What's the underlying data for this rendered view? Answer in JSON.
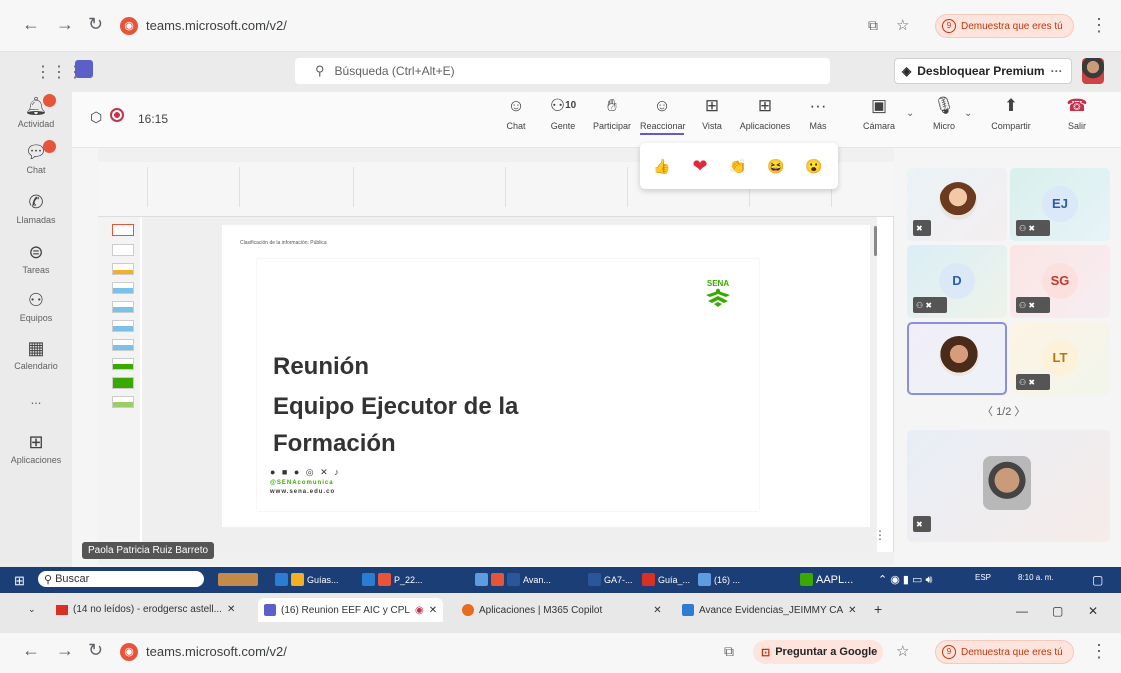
{
  "browser_top": {
    "url": "teams.microsoft.com/v2/",
    "profile_pill": "Demuestra que eres tú",
    "profile_badge": "9"
  },
  "teams_header": {
    "search_placeholder": "Búsqueda (Ctrl+Alt+E)",
    "premium_label": "Desbloquear Premium"
  },
  "rail": [
    {
      "label": "Actividad",
      "icon": "bell-icon"
    },
    {
      "label": "Chat",
      "icon": "chat-icon"
    },
    {
      "label": "Llamadas",
      "icon": "phone-icon"
    },
    {
      "label": "Tareas",
      "icon": "tasks-icon"
    },
    {
      "label": "Equipos",
      "icon": "teams-icon"
    },
    {
      "label": "Calendario",
      "icon": "calendar-icon"
    },
    {
      "label": "...",
      "icon": "more-icon"
    },
    {
      "label": "Aplicaciones",
      "icon": "apps-icon"
    }
  ],
  "meeting": {
    "time": "16:15",
    "participant_count": "10",
    "toolbar": [
      {
        "label": "Chat",
        "icon": "chat-icon"
      },
      {
        "label": "Gente",
        "icon": "people-icon"
      },
      {
        "label": "Participar",
        "icon": "raise-hand-icon"
      },
      {
        "label": "Reaccionar",
        "icon": "smiley-icon"
      },
      {
        "label": "Vista",
        "icon": "view-grid-icon"
      },
      {
        "label": "Aplicaciones",
        "icon": "add-app-icon"
      },
      {
        "label": "Más",
        "icon": "more-icon"
      },
      {
        "label": "Cámara",
        "icon": "camera-off-icon"
      },
      {
        "label": "Micro",
        "icon": "mic-off-icon"
      },
      {
        "label": "Compartir",
        "icon": "share-icon"
      },
      {
        "label": "Salir",
        "icon": "leave-icon"
      }
    ],
    "reactions": [
      {
        "icon": "like-icon",
        "glyph": "👍",
        "color": "#f2b024"
      },
      {
        "icon": "heart-icon",
        "glyph": "❤",
        "color": "#e02a3a"
      },
      {
        "icon": "clap-icon",
        "glyph": "👏",
        "color": "#f2b024"
      },
      {
        "icon": "laugh-icon",
        "glyph": "😆",
        "color": "#f2b024"
      },
      {
        "icon": "surprised-icon",
        "glyph": "😮",
        "color": "#f2b024"
      }
    ]
  },
  "slide": {
    "classification": "Clasificación de la información: Pública",
    "title_lines": [
      "Reunión",
      "Equipo Ejecutor de la",
      "Formación"
    ],
    "handle": "@SENAcomunica",
    "website": "www.sena.edu.co",
    "logo_text": "SENA",
    "social_icons": "● ■ ● ◎ ✕ ♪"
  },
  "presenter_name": "Paola Patricia Ruiz Barreto",
  "participants": {
    "tiles": [
      {
        "initials": "",
        "type": "photo"
      },
      {
        "initials": "EJ",
        "type": "avatar",
        "bg": "#dbe8f7",
        "fg": "#2c5ea8"
      },
      {
        "initials": "D",
        "type": "avatar",
        "bg": "#dbe8f7",
        "fg": "#2c5ea8"
      },
      {
        "initials": "SG",
        "type": "avatar",
        "bg": "#fbe0de",
        "fg": "#c23a2e"
      },
      {
        "initials": "",
        "type": "photo"
      },
      {
        "initials": "LT",
        "type": "avatar",
        "bg": "#fdf1d9",
        "fg": "#b07a10"
      }
    ],
    "pagination": "1/2"
  },
  "taskbar": {
    "search": "Buscar",
    "apps": [
      "Guías...",
      "P_22...",
      "Avan...",
      "GA7-...",
      "Guía_...",
      "(16) ...",
      "AAPL..."
    ],
    "lang": "ESP",
    "time": "8:10 a. m."
  },
  "tabs": [
    {
      "label": "(14 no leídos) - erodgersc astell...",
      "color": "#d93025"
    },
    {
      "label": "(16) Reunion EEF AIC y CPL",
      "color": "#5b5fc7"
    },
    {
      "label": "Aplicaciones | M365 Copilot",
      "color": "#e86b1f"
    },
    {
      "label": "Avance Evidencias_JEIMMY CA",
      "color": "#2b7cd3"
    }
  ],
  "browser_bottom": {
    "url": "teams.microsoft.com/v2/",
    "ask_google": "Preguntar a Google",
    "profile_pill": "Demuestra que eres tú"
  }
}
